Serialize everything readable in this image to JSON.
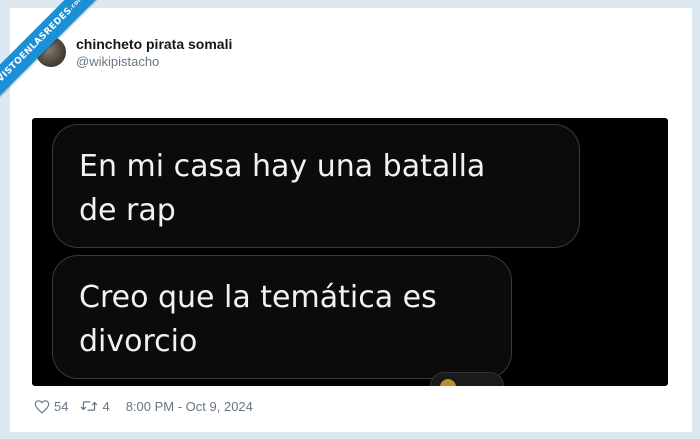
{
  "watermark": {
    "text": "VISTOENLASREDES",
    "suffix": ".com"
  },
  "tweet": {
    "display_name": "chincheto pirata somali",
    "handle": "@wikipistacho",
    "messages": [
      {
        "line1": "En mi casa hay una batalla",
        "line2": "de rap"
      },
      {
        "line1": "Creo que la temática es",
        "line2": "divorcio"
      }
    ],
    "likes": "54",
    "retweets": "4",
    "timestamp": "8:00 PM - Oct 9, 2024"
  },
  "colors": {
    "ribbon": "#1d8fd6",
    "background": "#dce9f2",
    "muted": "#657786"
  }
}
